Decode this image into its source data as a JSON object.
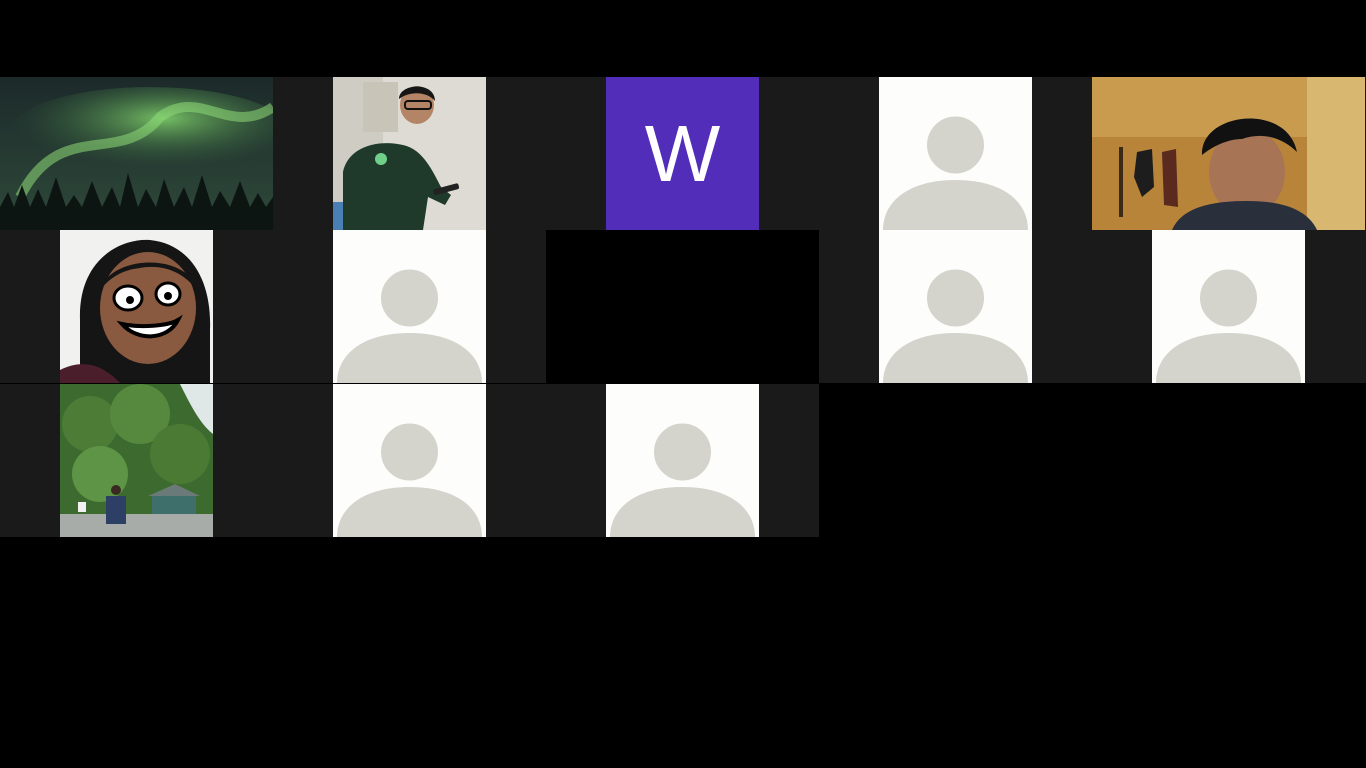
{
  "meeting": {
    "view": "gallery",
    "participant_count": 13
  },
  "colors": {
    "background": "#000000",
    "tile_band": "#1a1a1a",
    "avatar_bg": "#fdfdfb",
    "avatar_silhouette": "#d5d4cc",
    "initial_tile_bg": "#512db9"
  },
  "tiles": [
    {
      "kind": "video",
      "icon": "aurora-photo"
    },
    {
      "kind": "video",
      "icon": "person-with-phone-photo"
    },
    {
      "kind": "initial",
      "initial": "W"
    },
    {
      "kind": "avatar",
      "icon": "default-user-avatar-icon"
    },
    {
      "kind": "video",
      "icon": "person-webcam-photo"
    },
    {
      "kind": "video",
      "icon": "cartoon-face-photo"
    },
    {
      "kind": "avatar",
      "icon": "default-user-avatar-icon"
    },
    {
      "kind": "video-off",
      "icon": "black-screen"
    },
    {
      "kind": "avatar",
      "icon": "default-user-avatar-icon"
    },
    {
      "kind": "avatar",
      "icon": "default-user-avatar-icon"
    },
    {
      "kind": "video",
      "icon": "forest-hut-photo"
    },
    {
      "kind": "avatar",
      "icon": "default-user-avatar-icon"
    },
    {
      "kind": "avatar",
      "icon": "default-user-avatar-icon"
    }
  ]
}
